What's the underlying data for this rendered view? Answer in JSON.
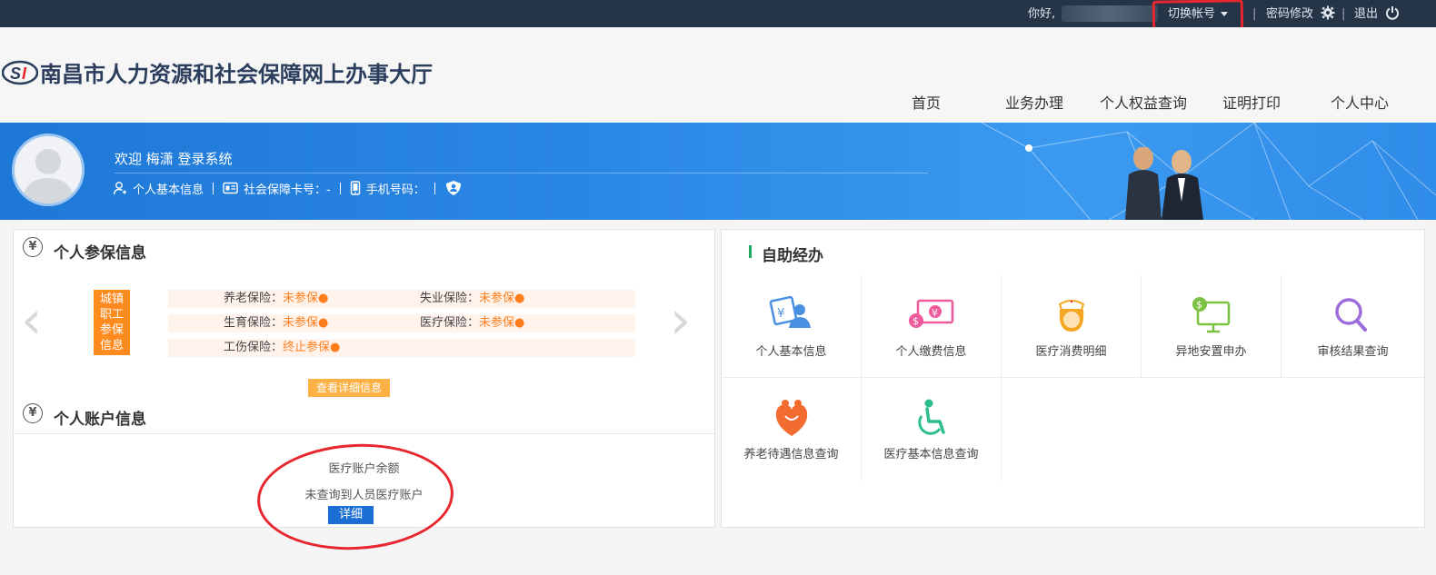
{
  "topbar": {
    "greeting": "你好,",
    "switch_account": "切换帐号",
    "change_password": "密码修改",
    "logout": "退出",
    "sep": "|"
  },
  "header": {
    "site_title": "南昌市人力资源和社会保障网上办事大厅",
    "nav": [
      "首页",
      "业务办理",
      "个人权益查询",
      "证明打印",
      "个人中心"
    ]
  },
  "banner": {
    "welcome": "欢迎 梅潇 登录系统",
    "basic_info": "个人基本信息",
    "ss_card": "社会保障卡号：-",
    "phone": "手机号码："
  },
  "insurance": {
    "title": "个人参保信息",
    "tag": "城镇职工参保信息",
    "items": [
      {
        "label": "养老保险：",
        "status": "未参保●"
      },
      {
        "label": "失业保险：",
        "status": "未参保●"
      },
      {
        "label": "生育保险：",
        "status": "未参保●"
      },
      {
        "label": "医疗保险：",
        "status": "未参保●"
      },
      {
        "label": "工伤保险：",
        "status": "终止参保●"
      }
    ],
    "detail_button": "查看详细信息"
  },
  "account": {
    "title": "个人账户信息",
    "balance_label": "医疗账户余额",
    "message": "未查询到人员医疗账户",
    "detail_button": "详细"
  },
  "self_service": {
    "title": "自助经办",
    "items": [
      {
        "label": "个人基本信息",
        "icon": "id-card-person-icon"
      },
      {
        "label": "个人缴费信息",
        "icon": "money-payment-icon"
      },
      {
        "label": "医疗消费明细",
        "icon": "nurse-icon"
      },
      {
        "label": "异地安置申办",
        "icon": "monitor-dollar-icon"
      },
      {
        "label": "审核结果查询",
        "icon": "magnifier-icon"
      },
      {
        "label": "养老待遇信息查询",
        "icon": "elderly-care-icon"
      },
      {
        "label": "医疗基本信息查询",
        "icon": "wheelchair-icon"
      }
    ]
  },
  "colors": {
    "topbar": "#253447",
    "banner": "#2a86e4",
    "orange": "#ff8a1e",
    "blue_button": "#1b6fd4",
    "annotation": "#e8262d"
  }
}
